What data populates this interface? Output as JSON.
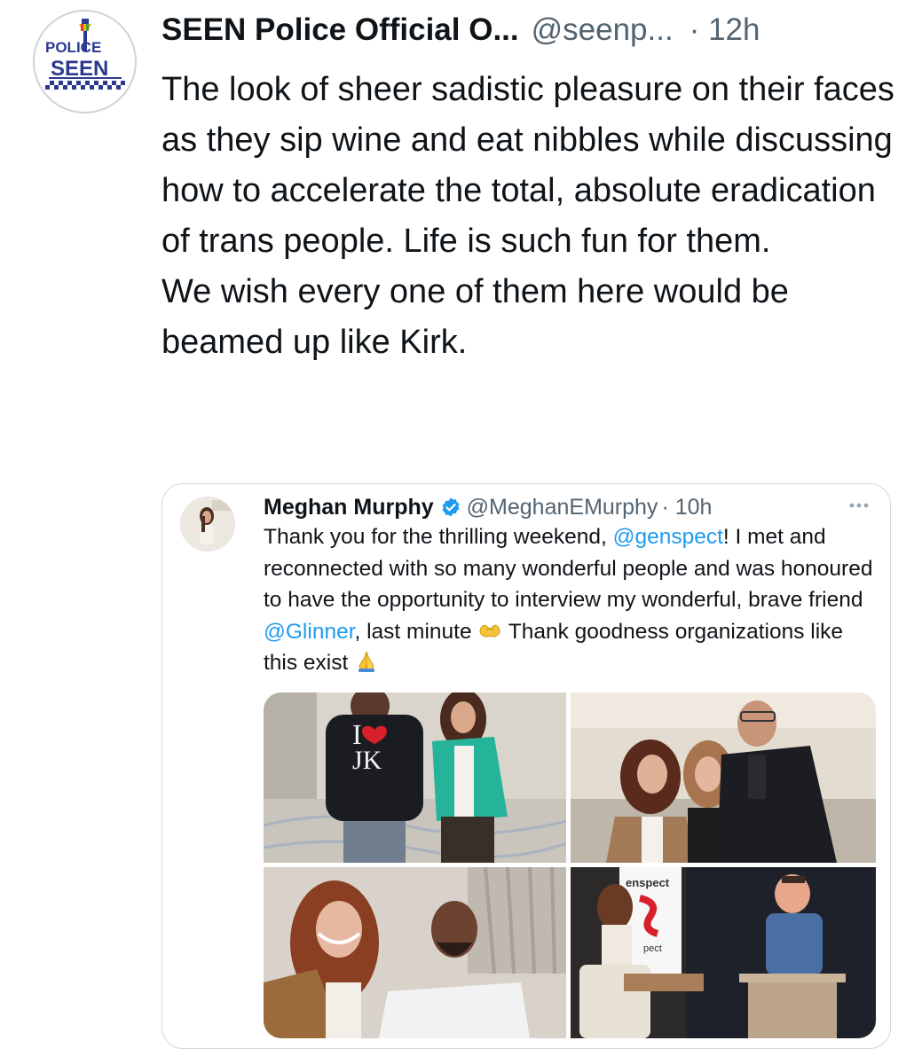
{
  "post": {
    "display_name": "SEEN Police Official O...",
    "handle": "@seenp...",
    "time": "· 12h",
    "avatar_text_top": "POLICE",
    "avatar_text_bottom": "SEEN",
    "text_lines": [
      "The look of sheer sadistic pleasure on their faces as they sip wine and eat nibbles while discussing how to accelerate the total, absolute eradication of trans people. Life is such fun for them.",
      "We wish every one of them here would be beamed up like Kirk."
    ]
  },
  "quote": {
    "display_name": "Meghan Murphy",
    "verified_icon": "verified-badge-icon",
    "handle": "@MeghanEMurphy",
    "time": "· 10h",
    "more_icon": "more-options-icon",
    "text": {
      "part1": "Thank you for the thrilling weekend, ",
      "mention1": "@genspect",
      "part2": "! I met and reconnected with so many wonderful people and was honoured to have the opportunity to interview my wonderful, brave friend ",
      "mention2": "@Glinner",
      "part3": ", last minute ",
      "emoji1": "heart-hands-emoji",
      "part4": " Thank goodness organizations like this exist ",
      "emoji2": "folded-hands-emoji"
    },
    "photos": [
      {
        "alt_icon": "photo-1",
        "shirt_text_top": "I",
        "shirt_text_bottom": "JK"
      },
      {
        "alt_icon": "photo-2"
      },
      {
        "alt_icon": "photo-3"
      },
      {
        "alt_icon": "photo-4",
        "banner_top": "enspect",
        "banner_bottom": "pect"
      }
    ]
  },
  "colors": {
    "link": "#1d9bf0",
    "secondary_text": "#536471",
    "primary_text": "#0f1419",
    "border": "#cfd9de"
  }
}
